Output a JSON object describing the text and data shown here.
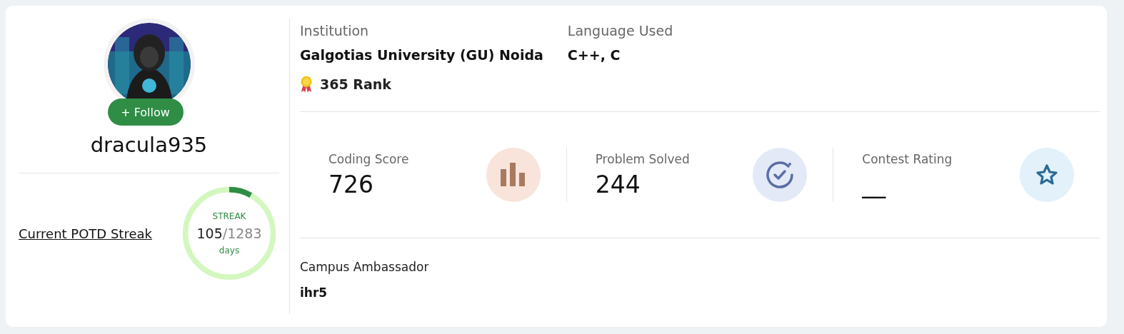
{
  "profile": {
    "follow_button": "+ Follow",
    "username": "dracula935"
  },
  "streak": {
    "label": "Current POTD Streak",
    "caption": "STREAK",
    "current": "105",
    "total": "/1283",
    "unit": "days"
  },
  "institution": {
    "label": "Institution",
    "value": "Galgotias University (GU) Noida",
    "rank": "365 Rank"
  },
  "language": {
    "label": "Language Used",
    "value": "C++, C"
  },
  "stats": [
    {
      "kind": "score",
      "label": "Coding Score",
      "value": "726"
    },
    {
      "kind": "solved",
      "label": "Problem Solved",
      "value": "244"
    },
    {
      "kind": "rating",
      "label": "Contest Rating",
      "value": "__"
    }
  ],
  "campus_ambassador": {
    "label": "Campus Ambassador",
    "value": "ihr5"
  }
}
